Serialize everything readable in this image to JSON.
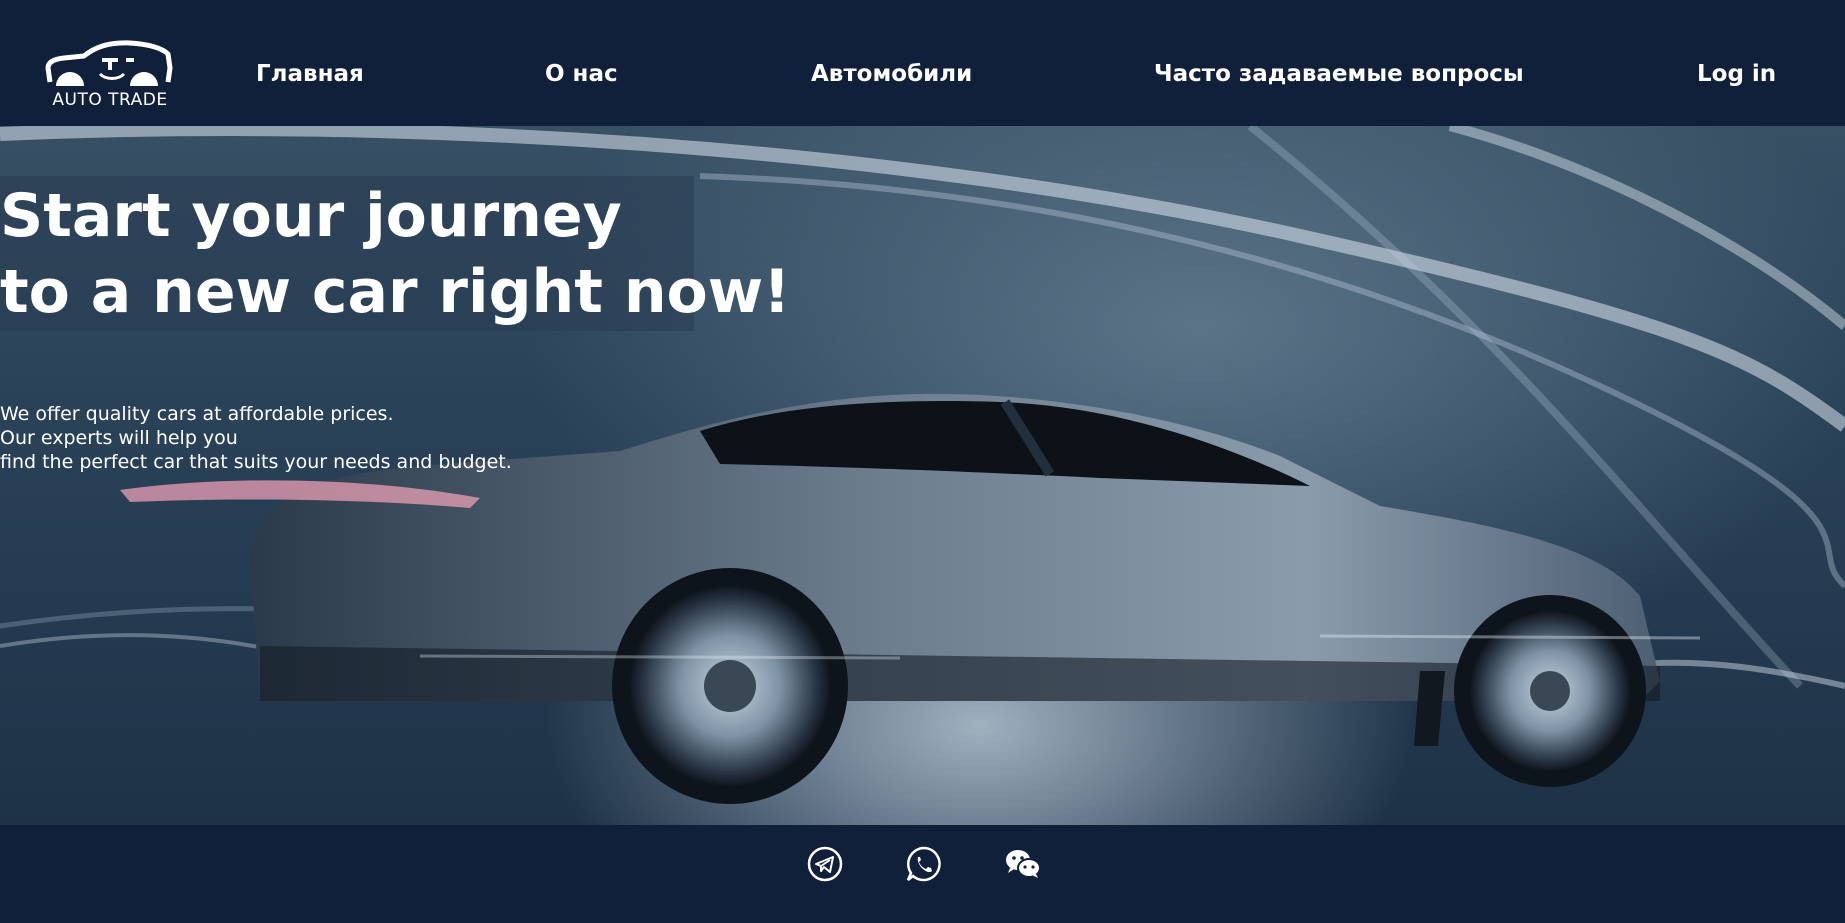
{
  "header": {
    "logo_text": "AUTO TRADE",
    "nav": [
      {
        "label": "Главная"
      },
      {
        "label": "О нас"
      },
      {
        "label": "Автомобили"
      },
      {
        "label": "Часто задаваемые вопросы"
      }
    ],
    "login_label": "Log in"
  },
  "hero": {
    "headline_line1": "Start your journey",
    "headline_line2": "to a new car right now!",
    "subtext_line1": "We offer quality cars at affordable prices.",
    "subtext_line2": "Our experts will help you",
    "subtext_line3": "find the perfect car that suits your needs and budget."
  },
  "footer": {
    "social_icons": [
      "telegram-icon",
      "whatsapp-icon",
      "wechat-icon"
    ]
  },
  "colors": {
    "header_bg": "#11203a",
    "footer_bg": "#11203a",
    "text": "#ffffff"
  }
}
